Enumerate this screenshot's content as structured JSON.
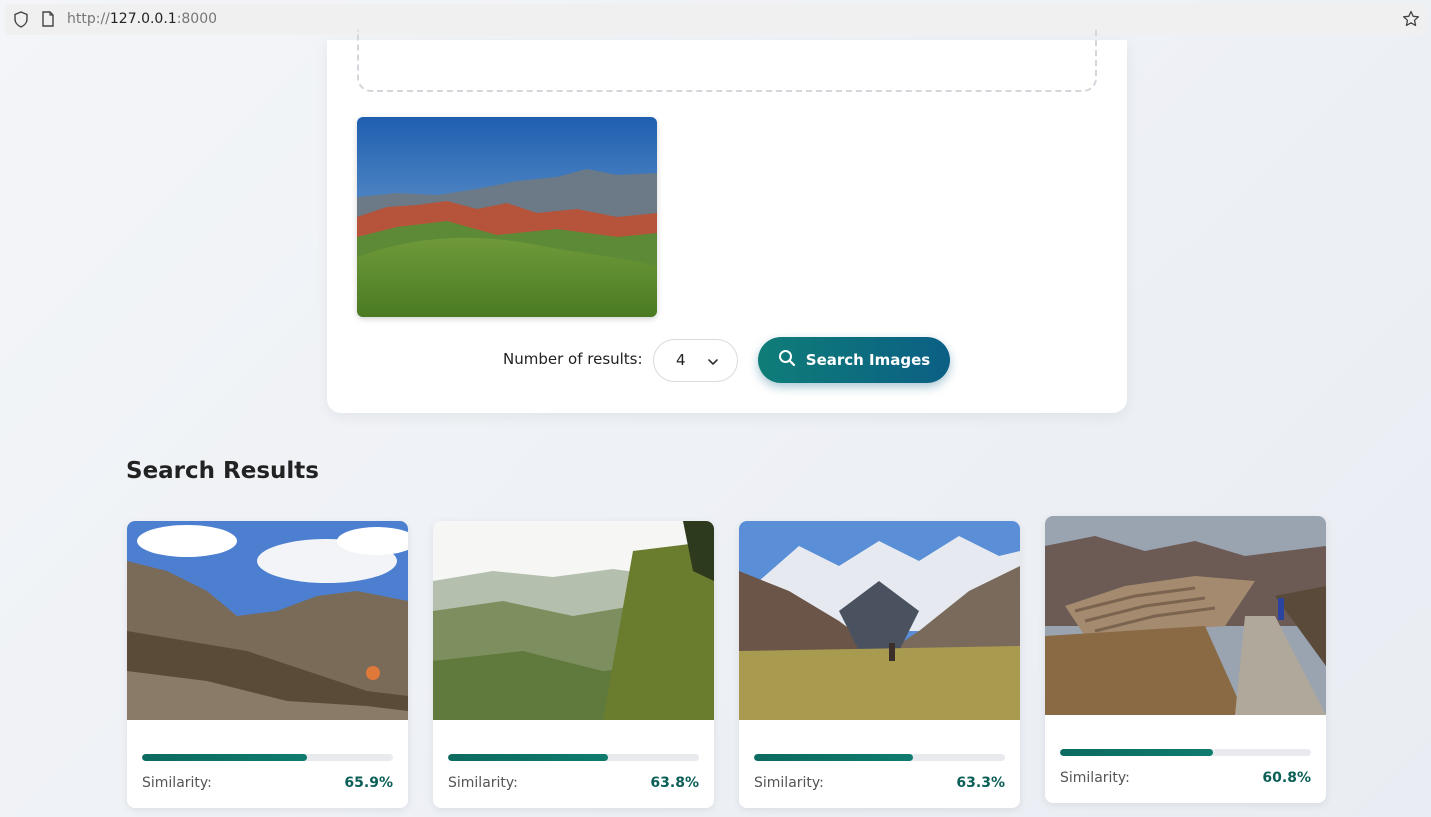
{
  "browser": {
    "url_scheme": "http://",
    "url_host": "127.0.0.1",
    "url_port": ":8000"
  },
  "search": {
    "results_label": "Number of results:",
    "results_count": "4",
    "button_label": "Search Images"
  },
  "results": {
    "title": "Search Results",
    "similarity_label": "Similarity:",
    "items": [
      {
        "score": "65.9%",
        "fraction": 0.659
      },
      {
        "score": "63.8%",
        "fraction": 0.638
      },
      {
        "score": "63.3%",
        "fraction": 0.633
      },
      {
        "score": "60.8%",
        "fraction": 0.608
      }
    ]
  },
  "colors": {
    "accent": "#0f7d78",
    "accent_dark": "#0b5f84",
    "score_text": "#0b5f57"
  }
}
